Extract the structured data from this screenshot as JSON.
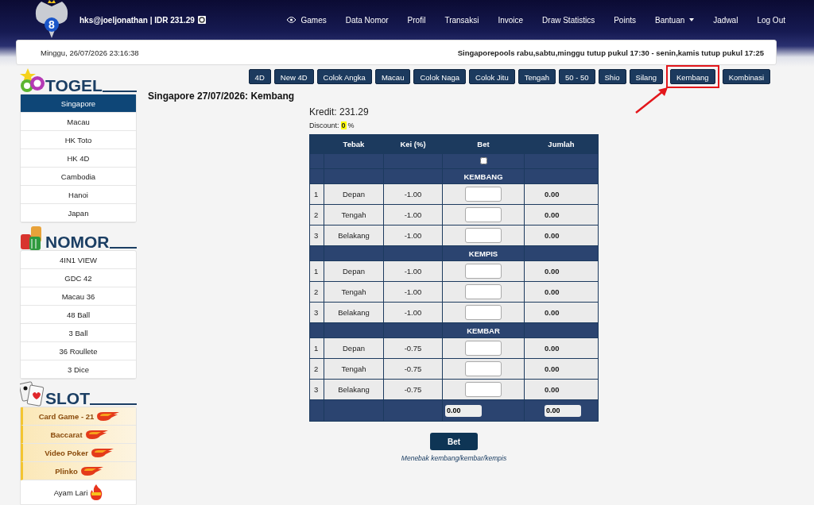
{
  "header": {
    "logo_text": "8",
    "user": "hks@joeljonathan | IDR 231.29",
    "nav": [
      {
        "label": "Games",
        "kind": "icon"
      },
      {
        "label": "Data Nomor",
        "kind": "plain"
      },
      {
        "label": "Profil",
        "kind": "plain"
      },
      {
        "label": "Transaksi",
        "kind": "plain"
      },
      {
        "label": "Invoice",
        "kind": "plain"
      },
      {
        "label": "Draw Statistics",
        "kind": "plain"
      },
      {
        "label": "Points",
        "kind": "plain"
      },
      {
        "label": "Bantuan",
        "kind": "menu"
      },
      {
        "label": "Jadwal",
        "kind": "plain"
      },
      {
        "label": "Log Out",
        "kind": "plain"
      }
    ]
  },
  "info_bar": {
    "datetime": "Minggu, 26/07/2026 23:16:38",
    "notice": "Singaporepools rabu,sabtu,minggu tutup pukul 17:30 - senin,kamis tutup pukul 17:25"
  },
  "sidebar": [
    {
      "title": "TOGEL",
      "kind": "balls",
      "items": [
        {
          "label": "Singapore",
          "selected": true,
          "kind": "plain"
        },
        {
          "label": "Macau",
          "selected": false,
          "kind": "plain"
        },
        {
          "label": "HK Toto",
          "selected": false,
          "kind": "plain"
        },
        {
          "label": "HK 4D",
          "selected": false,
          "kind": "plain"
        },
        {
          "label": "Cambodia",
          "selected": false,
          "kind": "plain"
        },
        {
          "label": "Hanoi",
          "selected": false,
          "kind": "plain"
        },
        {
          "label": "Japan",
          "selected": false,
          "kind": "plain"
        }
      ]
    },
    {
      "title": "NOMOR",
      "kind": "chips",
      "items": [
        {
          "label": "4IN1 VIEW",
          "selected": false,
          "kind": "plain"
        },
        {
          "label": "GDC 42",
          "selected": false,
          "kind": "plain"
        },
        {
          "label": "Macau 36",
          "selected": false,
          "kind": "plain"
        },
        {
          "label": "48 Ball",
          "selected": false,
          "kind": "plain"
        },
        {
          "label": "3 Ball",
          "selected": false,
          "kind": "plain"
        },
        {
          "label": "36 Roullete",
          "selected": false,
          "kind": "plain"
        },
        {
          "label": "3 Dice",
          "selected": false,
          "kind": "plain"
        }
      ]
    },
    {
      "title": "SLOT",
      "kind": "cards",
      "items": [
        {
          "label": "Card Game - 21",
          "selected": false,
          "kind": "hot"
        },
        {
          "label": "Baccarat",
          "selected": false,
          "kind": "hot"
        },
        {
          "label": "Video Poker",
          "selected": false,
          "kind": "hot"
        },
        {
          "label": "Plinko",
          "selected": false,
          "kind": "hot"
        },
        {
          "label": "Ayam Lari",
          "selected": false,
          "kind": "fire"
        }
      ]
    }
  ],
  "tabs": [
    {
      "label": "4D",
      "highlighted": false
    },
    {
      "label": "New 4D",
      "highlighted": false
    },
    {
      "label": "Colok Angka",
      "highlighted": false
    },
    {
      "label": "Macau",
      "highlighted": false
    },
    {
      "label": "Colok Naga",
      "highlighted": false
    },
    {
      "label": "Colok Jitu",
      "highlighted": false
    },
    {
      "label": "Tengah",
      "highlighted": false
    },
    {
      "label": "50 - 50",
      "highlighted": false
    },
    {
      "label": "Shio",
      "highlighted": false
    },
    {
      "label": "Silang",
      "highlighted": false
    },
    {
      "label": "Kembang",
      "highlighted": true
    },
    {
      "label": "Kombinasi",
      "highlighted": false
    }
  ],
  "page_title": "Singapore 27/07/2026: Kembang",
  "credit": "Kredit: 231.29",
  "discount": {
    "label": "Discount:",
    "value": "0",
    "unit": "%"
  },
  "table": {
    "columns": [
      "Tebak",
      "Kei (%)",
      "Bet",
      "Jumlah"
    ],
    "select_all": {
      "checked": false
    },
    "groups": [
      {
        "title": "KEMBANG",
        "rows": [
          {
            "no": "1",
            "tebak": "Depan",
            "kei": "-1.00",
            "jumlah": "0.00"
          },
          {
            "no": "2",
            "tebak": "Tengah",
            "kei": "-1.00",
            "jumlah": "0.00"
          },
          {
            "no": "3",
            "tebak": "Belakang",
            "kei": "-1.00",
            "jumlah": "0.00"
          }
        ]
      },
      {
        "title": "KEMPIS",
        "rows": [
          {
            "no": "1",
            "tebak": "Depan",
            "kei": "-1.00",
            "jumlah": "0.00"
          },
          {
            "no": "2",
            "tebak": "Tengah",
            "kei": "-1.00",
            "jumlah": "0.00"
          },
          {
            "no": "3",
            "tebak": "Belakang",
            "kei": "-1.00",
            "jumlah": "0.00"
          }
        ]
      },
      {
        "title": "KEMBAR",
        "rows": [
          {
            "no": "1",
            "tebak": "Depan",
            "kei": "-0.75",
            "jumlah": "0.00"
          },
          {
            "no": "2",
            "tebak": "Tengah",
            "kei": "-0.75",
            "jumlah": "0.00"
          },
          {
            "no": "3",
            "tebak": "Belakang",
            "kei": "-0.75",
            "jumlah": "0.00"
          }
        ]
      }
    ],
    "totals": {
      "bet": "0.00",
      "jumlah": "0.00"
    }
  },
  "bet_button": "Bet",
  "hint": "Menebak kembang/kembar/kempis"
}
